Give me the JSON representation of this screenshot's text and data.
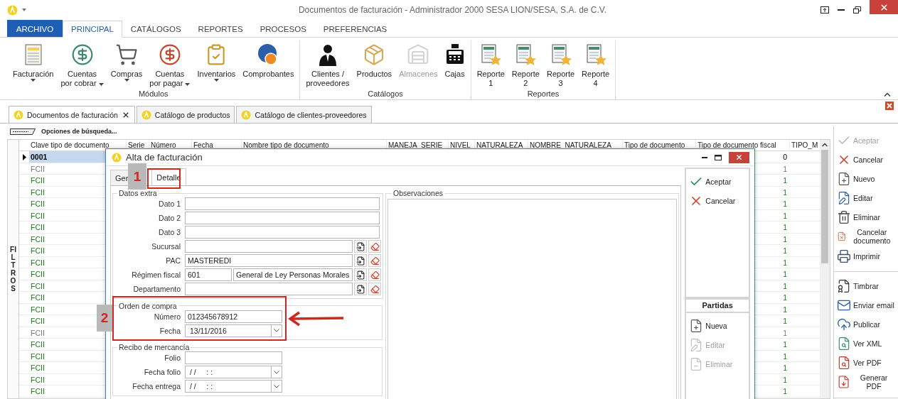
{
  "window": {
    "title": "Documentos de facturación - Administrador 2000 SESA LION/SESA, S.A. de C.V."
  },
  "ribbon_tabs": [
    {
      "label": "ARCHIVO",
      "kind": "file",
      "selected": false
    },
    {
      "label": "PRINCIPAL",
      "kind": "tab",
      "selected": true
    },
    {
      "label": "CATÁLOGOS",
      "kind": "tab",
      "selected": false
    },
    {
      "label": "REPORTES",
      "kind": "tab",
      "selected": false
    },
    {
      "label": "PROCESOS",
      "kind": "tab",
      "selected": false
    },
    {
      "label": "PREFERENCIAS",
      "kind": "tab",
      "selected": false
    }
  ],
  "ribbon_groups": [
    {
      "label": "Módulos",
      "items": [
        {
          "label": "Facturación",
          "dropdown": true,
          "disabled": false
        },
        {
          "label": "Cuentas\npor cobrar",
          "dropdown": true,
          "disabled": false
        },
        {
          "label": "Compras",
          "dropdown": true,
          "disabled": false
        },
        {
          "label": "Cuentas\npor pagar",
          "dropdown": true,
          "disabled": false
        },
        {
          "label": "Inventarios",
          "dropdown": true,
          "disabled": false
        },
        {
          "label": "Comprobantes",
          "dropdown": false,
          "disabled": false
        }
      ]
    },
    {
      "label": "Catálogos",
      "items": [
        {
          "label": "Clientes /\nproveedores",
          "dropdown": false,
          "disabled": false
        },
        {
          "label": "Productos",
          "dropdown": false,
          "disabled": false
        },
        {
          "label": "Almacenes",
          "dropdown": false,
          "disabled": true
        },
        {
          "label": "Cajas",
          "dropdown": false,
          "disabled": false
        }
      ]
    },
    {
      "label": "Reportes",
      "items": [
        {
          "label": "Reporte\n1",
          "dropdown": false,
          "disabled": false
        },
        {
          "label": "Reporte\n2",
          "dropdown": false,
          "disabled": false
        },
        {
          "label": "Reporte\n3",
          "dropdown": false,
          "disabled": false
        },
        {
          "label": "Reporte\n4",
          "dropdown": false,
          "disabled": false
        }
      ]
    }
  ],
  "document_tabs": [
    {
      "label": "Documentos de facturación",
      "selected": true
    },
    {
      "label": "Catálogo de productos",
      "selected": false
    },
    {
      "label": "Catálogo de clientes-proveedores",
      "selected": false
    }
  ],
  "search_options": "Opciones de búsqueda...",
  "filters_label": "FILTROS",
  "grid": {
    "columns": [
      "Clave tipo de documento",
      "Serie",
      "Número",
      "Fecha",
      "Nombre tipo de documento",
      "MANEJA_SERIE",
      "NIVEL",
      "NATURALEZA",
      "NOMBRE_NATURALEZA",
      "Tipo de documento",
      "Tipo de documento fiscal",
      "TIPO_M"
    ],
    "rows": [
      {
        "key": "0001",
        "value": "0",
        "selected": true,
        "muted": false
      },
      {
        "key": "FCII",
        "value": "1",
        "selected": false,
        "muted": true
      },
      {
        "key": "FCII",
        "value": "1",
        "selected": false,
        "muted": false
      },
      {
        "key": "FCII",
        "value": "1",
        "selected": false,
        "muted": false
      },
      {
        "key": "FCII",
        "value": "1",
        "selected": false,
        "muted": false
      },
      {
        "key": "FCII",
        "value": "1",
        "selected": false,
        "muted": false
      },
      {
        "key": "FCII",
        "value": "1",
        "selected": false,
        "muted": false
      },
      {
        "key": "FCII",
        "value": "1",
        "selected": false,
        "muted": false
      },
      {
        "key": "FCII",
        "value": "1",
        "selected": false,
        "muted": false
      },
      {
        "key": "FCII",
        "value": "1",
        "selected": false,
        "muted": false
      },
      {
        "key": "FCII",
        "value": "1",
        "selected": false,
        "muted": false
      },
      {
        "key": "FCII",
        "value": "1",
        "selected": false,
        "muted": false
      },
      {
        "key": "FCII",
        "value": "1",
        "selected": false,
        "muted": false
      },
      {
        "key": "FCII",
        "value": "1",
        "selected": false,
        "muted": false
      },
      {
        "key": "FCII",
        "value": "1",
        "selected": false,
        "muted": false
      },
      {
        "key": "FCII",
        "value": "1",
        "selected": false,
        "muted": true
      },
      {
        "key": "FCII",
        "value": "1",
        "selected": false,
        "muted": false
      },
      {
        "key": "FCII",
        "value": "1",
        "selected": false,
        "muted": false
      },
      {
        "key": "FCII",
        "value": "1",
        "selected": false,
        "muted": false
      },
      {
        "key": "FCII",
        "value": "1",
        "selected": false,
        "muted": false
      },
      {
        "key": "FCII",
        "value": "1",
        "selected": false,
        "muted": false
      }
    ]
  },
  "dialog": {
    "title": "Alta de facturación",
    "tabs": [
      {
        "label": "Ger",
        "selected": false
      },
      {
        "label": "Detalle",
        "selected": true
      }
    ],
    "groups": [
      {
        "label": "Datos extra",
        "fields": [
          {
            "label": "Dato 1",
            "kind": "text"
          },
          {
            "label": "Dato 2",
            "kind": "text"
          },
          {
            "label": "Dato 3",
            "kind": "text"
          },
          {
            "label": "Sucursal",
            "kind": "lookup"
          },
          {
            "label": "PAC",
            "kind": "lookup",
            "value": "MASTEREDI"
          },
          {
            "label": "Régimen fiscal",
            "kind": "code_lookup",
            "value": "601",
            "description": "General de Ley Personas Morales"
          },
          {
            "label": "Departamento",
            "kind": "lookup"
          }
        ]
      },
      {
        "label": "Orden de compra",
        "fields": [
          {
            "label": "Número",
            "kind": "short",
            "value": "012345678912"
          },
          {
            "label": "Fecha",
            "kind": "date",
            "value": "13/11/2016"
          }
        ]
      },
      {
        "label": "Recibo de mercancía",
        "fields": [
          {
            "label": "Folio",
            "kind": "short"
          },
          {
            "label": "Fecha folio",
            "kind": "date",
            "value": "/ /     : :"
          },
          {
            "label": "Fecha entrega",
            "kind": "date",
            "value": "/ /     : :"
          }
        ]
      }
    ],
    "observations_label": "Observaciones",
    "actions": [
      {
        "label": "Aceptar",
        "disabled": false
      },
      {
        "label": "Cancelar",
        "disabled": false
      }
    ],
    "items_title": "Partidas",
    "item_actions": [
      {
        "label": "Nueva",
        "disabled": false
      },
      {
        "label": "Editar",
        "disabled": true
      },
      {
        "label": "Eliminar",
        "disabled": true
      }
    ]
  },
  "annotations": [
    {
      "label": "1"
    },
    {
      "label": "2"
    }
  ],
  "side_action_groups": [
    {
      "items": [
        {
          "label": "Aceptar",
          "disabled": true
        },
        {
          "label": "Cancelar",
          "disabled": false
        },
        {
          "label": "Nuevo",
          "disabled": false
        },
        {
          "label": "Editar",
          "disabled": false
        },
        {
          "label": "Eliminar",
          "disabled": false
        },
        {
          "label": "Cancelar documento",
          "disabled": false
        },
        {
          "label": "Imprimir",
          "disabled": false
        }
      ]
    },
    {
      "items": [
        {
          "label": "Timbrar",
          "disabled": false
        },
        {
          "label": "Enviar email",
          "disabled": false
        },
        {
          "label": "Publicar",
          "disabled": false
        },
        {
          "label": "Ver XML",
          "disabled": false
        },
        {
          "label": "Ver PDF",
          "disabled": false
        },
        {
          "label": "Generar PDF",
          "disabled": false
        }
      ]
    }
  ]
}
